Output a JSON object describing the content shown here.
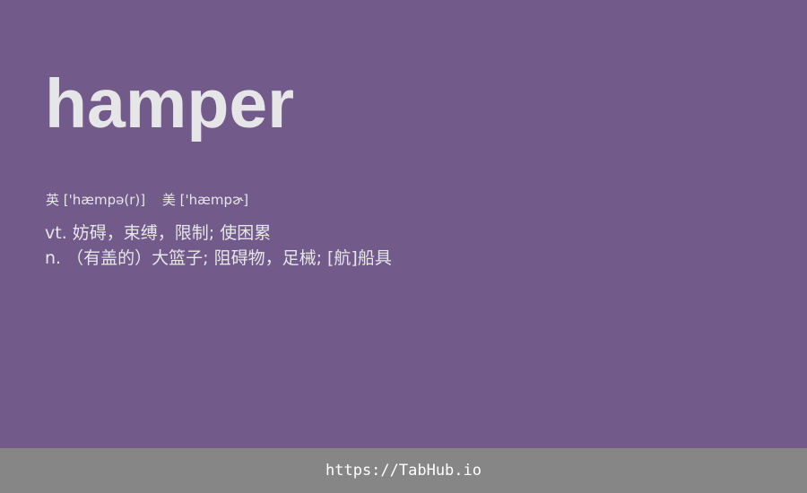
{
  "entry": {
    "word": "hamper",
    "phonetics": {
      "uk": "英 ['hæmpə(r)]",
      "us": "美 ['hæmpɚ]"
    },
    "definitions": [
      "vt. 妨碍，束缚，限制; 使困累",
      "n. （有盖的）大篮子; 阻碍物，足械; [航]船具"
    ]
  },
  "footer": {
    "link_text": "https://TabHub.io"
  },
  "colors": {
    "background": "#725a8a",
    "text": "#e6e6e8",
    "footer_background": "#868686",
    "footer_text": "#ffffff"
  }
}
